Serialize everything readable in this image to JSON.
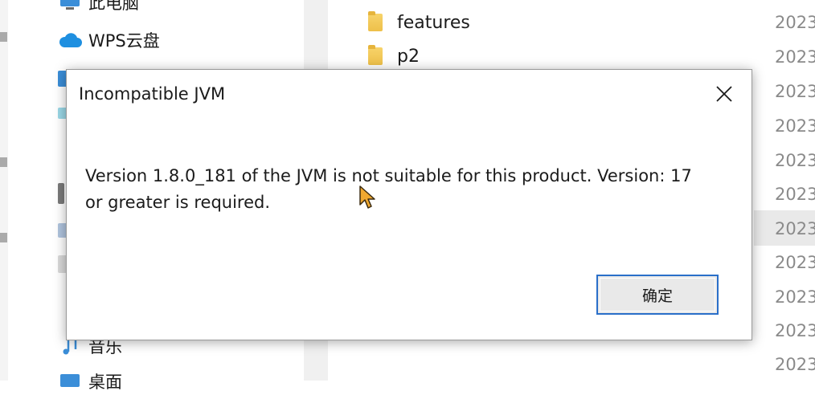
{
  "explorer": {
    "sidebar": {
      "items": [
        {
          "label": "此电脑",
          "icon": "computer-icon"
        },
        {
          "label": "WPS云盘",
          "icon": "cloud-icon"
        },
        {
          "label": "音乐",
          "icon": "music-icon"
        },
        {
          "label": "桌面",
          "icon": "desktop-icon"
        }
      ]
    },
    "files": [
      {
        "name": "features",
        "icon": "folder-icon"
      },
      {
        "name": "p2",
        "icon": "folder-icon"
      }
    ],
    "dates": [
      "2023",
      "2023",
      "2023",
      "2023",
      "2023",
      "2023",
      "2023",
      "2023",
      "2023",
      "2023",
      "2023"
    ]
  },
  "dialog": {
    "title": "Incompatible JVM",
    "message": "Version 1.8.0_181 of the JVM is not suitable for this product. Version: 17 or greater is required.",
    "ok_label": "确定",
    "close_icon": "close-icon"
  },
  "colors": {
    "accent": "#2a6fc9",
    "folder": "#eec04a",
    "cloud": "#1e8fe0",
    "date_text": "#8a8a8a"
  }
}
